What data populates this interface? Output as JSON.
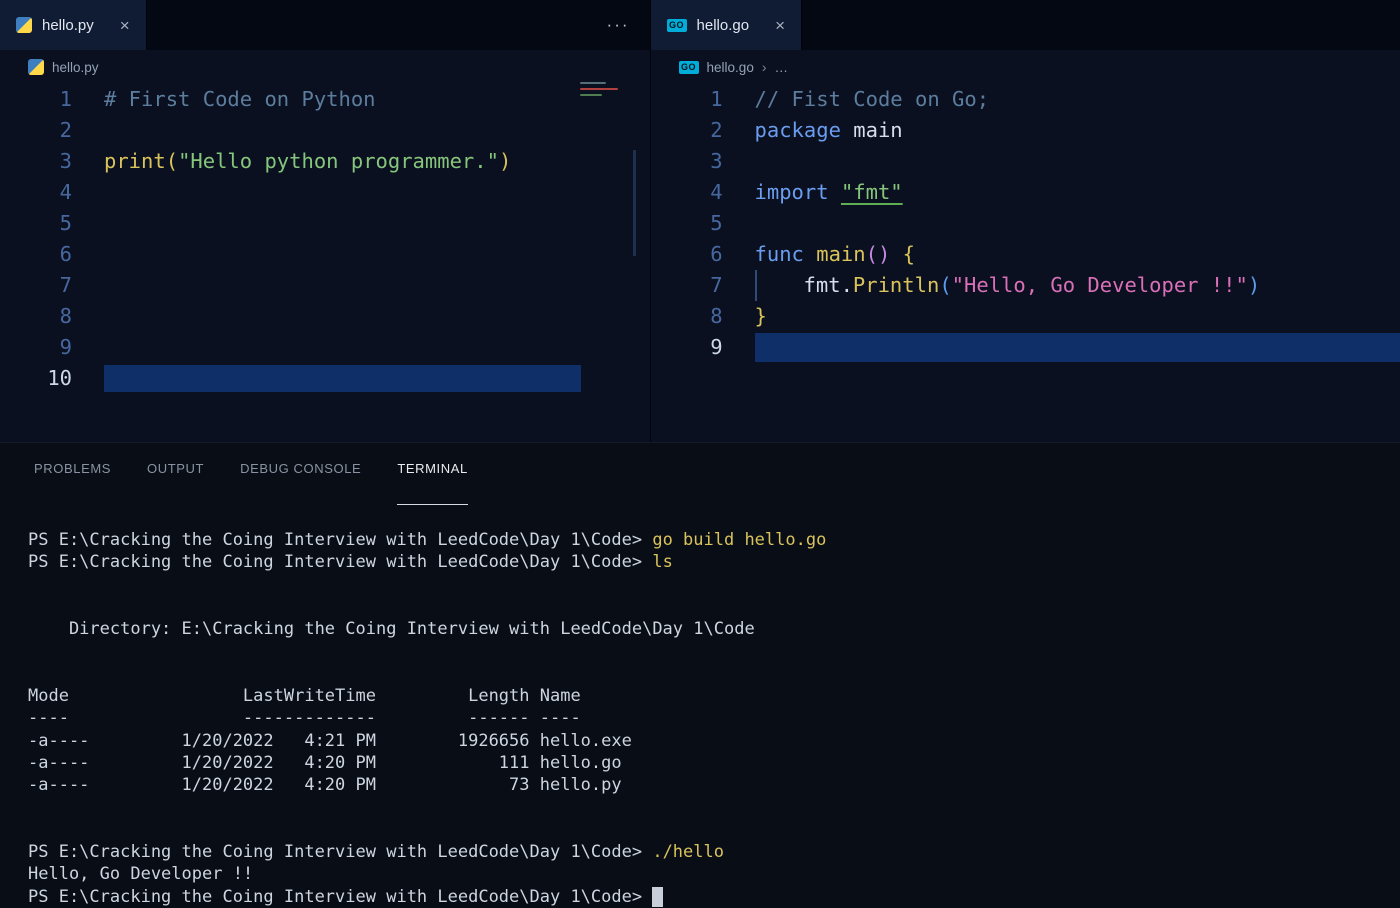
{
  "icons": {
    "go_badge": "GO",
    "ellipsis": "···",
    "close": "×",
    "breadcrumb_sep": "›",
    "breadcrumb_more": "…"
  },
  "left_editor": {
    "tab_label": "hello.py",
    "breadcrumb_file": "hello.py",
    "lines": [
      {
        "n": "1",
        "tk": [
          [
            "# First Code on Python",
            "comment"
          ]
        ]
      },
      {
        "n": "2",
        "tk": []
      },
      {
        "n": "3",
        "tk": [
          [
            "print",
            "fn"
          ],
          [
            "(",
            "bracket-y"
          ],
          [
            "\"Hello python programmer.\"",
            "str-g"
          ],
          [
            ")",
            "bracket-y"
          ]
        ]
      },
      {
        "n": "4",
        "tk": []
      },
      {
        "n": "5",
        "tk": []
      },
      {
        "n": "6",
        "tk": []
      },
      {
        "n": "7",
        "tk": []
      },
      {
        "n": "8",
        "tk": []
      },
      {
        "n": "9",
        "tk": []
      },
      {
        "n": "10",
        "tk": [],
        "hl": "partial",
        "active": true
      }
    ]
  },
  "right_editor": {
    "tab_label": "hello.go",
    "breadcrumb_file": "hello.go",
    "lines": [
      {
        "n": "1",
        "tk": [
          [
            "// Fist Code on Go;",
            "comment"
          ]
        ]
      },
      {
        "n": "2",
        "tk": [
          [
            "package",
            "kw"
          ],
          [
            " ",
            ""
          ],
          [
            "main",
            ""
          ]
        ]
      },
      {
        "n": "3",
        "tk": []
      },
      {
        "n": "4",
        "tk": [
          [
            "import",
            "kw"
          ],
          [
            " ",
            ""
          ],
          [
            "\"fmt\"",
            "str-g u"
          ]
        ]
      },
      {
        "n": "5",
        "tk": []
      },
      {
        "n": "6",
        "tk": [
          [
            "func",
            "kw"
          ],
          [
            " ",
            ""
          ],
          [
            "main",
            "fn"
          ],
          [
            "(",
            "paren-p"
          ],
          [
            ")",
            "paren-p"
          ],
          [
            " ",
            ""
          ],
          [
            "{",
            "bracket-y"
          ]
        ]
      },
      {
        "n": "7",
        "tk": [
          [
            "",
            "guide"
          ],
          [
            "fmt",
            ""
          ],
          [
            ".",
            ""
          ],
          [
            "Println",
            "fn"
          ],
          [
            "(",
            "paren-b"
          ],
          [
            "\"Hello, Go Developer !!\"",
            "str-p"
          ],
          [
            ")",
            "paren-b"
          ]
        ]
      },
      {
        "n": "8",
        "tk": [
          [
            "}",
            "bracket-y"
          ]
        ]
      },
      {
        "n": "9",
        "tk": [],
        "hl": "full",
        "active": true
      }
    ]
  },
  "panel": {
    "tabs": [
      "PROBLEMS",
      "OUTPUT",
      "DEBUG CONSOLE",
      "TERMINAL"
    ],
    "active_tab": "TERMINAL"
  },
  "terminal": {
    "lines": [
      [
        [
          "PS E:\\Cracking the Coing Interview with LeedCode\\Day 1\\Code> ",
          "p"
        ],
        [
          "go build hello.go",
          "c"
        ]
      ],
      [
        [
          "PS E:\\Cracking the Coing Interview with LeedCode\\Day 1\\Code> ",
          "p"
        ],
        [
          "ls",
          "c"
        ]
      ],
      [],
      [],
      [
        [
          "    Directory: E:\\Cracking the Coing Interview with LeedCode\\Day 1\\Code",
          "p"
        ]
      ],
      [],
      [],
      [
        [
          "Mode                 LastWriteTime         Length Name",
          "p"
        ]
      ],
      [
        [
          "----                 -------------         ------ ----",
          "p"
        ]
      ],
      [
        [
          "-a----         1/20/2022   4:21 PM        1926656 hello.exe",
          "p"
        ]
      ],
      [
        [
          "-a----         1/20/2022   4:20 PM            111 hello.go",
          "p"
        ]
      ],
      [
        [
          "-a----         1/20/2022   4:20 PM             73 hello.py",
          "p"
        ]
      ],
      [],
      [],
      [
        [
          "PS E:\\Cracking the Coing Interview with LeedCode\\Day 1\\Code> ",
          "p"
        ],
        [
          "./hello",
          "c"
        ]
      ],
      [
        [
          "Hello, Go Developer !!",
          "p"
        ]
      ],
      [
        [
          "PS E:\\Cracking the Coing Interview with LeedCode\\Day 1\\Code> ",
          "p"
        ],
        [
          " ",
          "cursor"
        ]
      ]
    ]
  }
}
